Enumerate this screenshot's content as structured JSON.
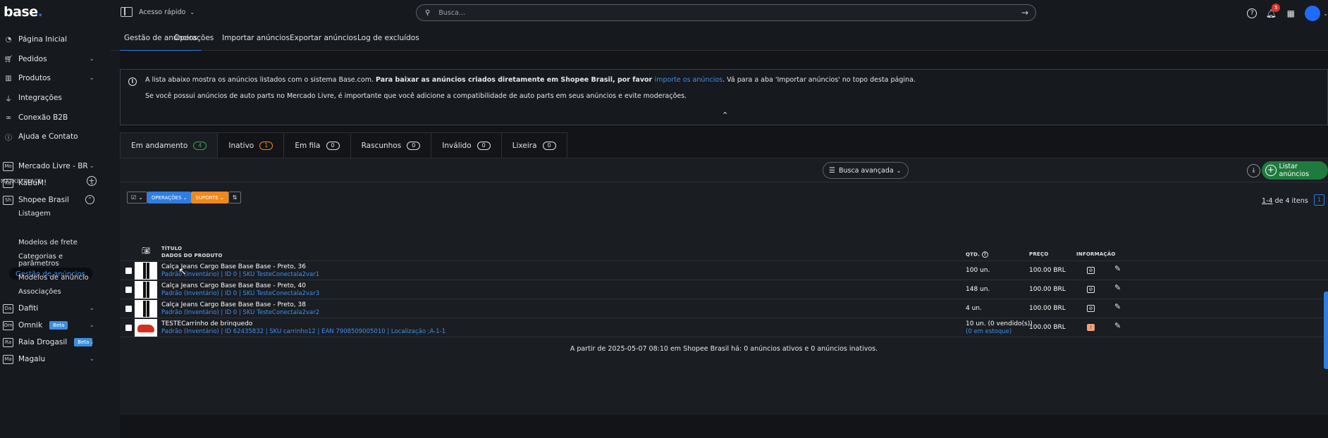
{
  "brand": {
    "logo": "base",
    "logo_dot": "."
  },
  "sidebar": {
    "items": [
      {
        "label": "Página Inicial",
        "icon": "gauge-icon"
      },
      {
        "label": "Pedidos",
        "icon": "cart-icon"
      },
      {
        "label": "Produtos",
        "icon": "chart-icon"
      },
      {
        "label": "Integrações",
        "icon": "plug-icon"
      },
      {
        "label": "Conexão B2B",
        "icon": "link-icon"
      },
      {
        "label": "Ajuda e Contato",
        "icon": "help-icon"
      }
    ],
    "marketplace_label": "MARKETPLACE",
    "marketplaces": [
      {
        "badge": "Mo",
        "label": "Mercado Livre - BR"
      },
      {
        "badge": "Ka",
        "label": "KaBuM!"
      },
      {
        "badge": "Sh",
        "label": "Shopee Brasil"
      }
    ],
    "shopee_sub": [
      "Listagem",
      "Gestão de anúncios",
      "Modelos de frete",
      "Categorias e",
      "parâmetros",
      "Modelos de anúncio",
      "Associações"
    ],
    "marketplaces2": [
      {
        "badge": "Da",
        "label": "Dafiti",
        "beta": ""
      },
      {
        "badge": "Om",
        "label": "Omnik",
        "beta": "Beta"
      },
      {
        "badge": "Ra",
        "label": "Raia Drogasil",
        "beta": "Beta"
      },
      {
        "badge": "Ma",
        "label": "Magalu",
        "beta": ""
      }
    ]
  },
  "topbar": {
    "quick_access": "Acesso rápido",
    "search_placeholder": "Busca...",
    "notifications": "5"
  },
  "tabs": [
    "Gestão de anúncios",
    "Operações",
    "Importar anúncios",
    "Exportar anúncios",
    "Log de excluídos"
  ],
  "info": {
    "line1_a": "A lista abaixo mostra os anúncios listados com o sistema Base.com. ",
    "line1_b": "Para baixar as anúncios criados diretamente em Shopee Brasil, por favor ",
    "line1_link": "importe os anúncios",
    "line1_c": ". Vá para a aba 'Importar anúncios' no topo desta página.",
    "line2": "Se você possui anúncios de auto parts no Mercado Livre, é importante que você adicione a compatibilidade de auto parts em seus anúncios e evite moderações."
  },
  "status_tabs": [
    {
      "label": "Em andamento",
      "count": "4"
    },
    {
      "label": "Inativo",
      "count": "1"
    },
    {
      "label": "Em fila",
      "count": "0"
    },
    {
      "label": "Rascunhos",
      "count": "0"
    },
    {
      "label": "Inválido",
      "count": "0"
    },
    {
      "label": "Lixeira",
      "count": "0"
    }
  ],
  "toolbar": {
    "advanced_search": "Busca avançada",
    "list_button": "Listar anúncios",
    "operations": "OPERAÇÕES",
    "support": "SUPORTE",
    "pager_range": "1-4",
    "pager_rest": " de 4 itens",
    "page": "1"
  },
  "table": {
    "headers": {
      "title": "TÍTULO",
      "product": "DADOS DO PRODUTO",
      "qty": "QTD.",
      "price": "PREÇO",
      "info": "INFORMAÇÃO"
    },
    "rows": [
      {
        "title": "Calça Jeans Cargo Base Base Base - Preto, 36",
        "sub": "Padrão (Inventário) | ID 0 | SKU TesteConectala2var1",
        "qty": "100 un.",
        "price": "100.00 BRL"
      },
      {
        "title": "Calça Jeans Cargo Base Base Base - Preto, 40",
        "sub": "Padrão (Inventário) | ID 0 | SKU TesteConectala2var3",
        "qty": "148 un.",
        "price": "100.00 BRL"
      },
      {
        "title": "Calça Jeans Cargo Base Base Base - Preto, 38",
        "sub": "Padrão (Inventário) | ID 0 | SKU TesteConectala2var2",
        "qty": "4 un.",
        "price": "100.00 BRL"
      },
      {
        "title": "TESTECarrinho de brinquedo",
        "sub": "Padrão (Inventário) | ID 62435832 | SKU carrinho12 | EAN 7908509005010 | Localização ;A-1-1",
        "qty": "10 un. (0 vendido(s))",
        "qty_extra": "(0 em estoque)",
        "price": "100.00 BRL"
      }
    ],
    "footer": "A partir de 2025-05-07 08:10 em Shopee Brasil há: 0 anúncios ativos e 0 anúncios inativos."
  }
}
